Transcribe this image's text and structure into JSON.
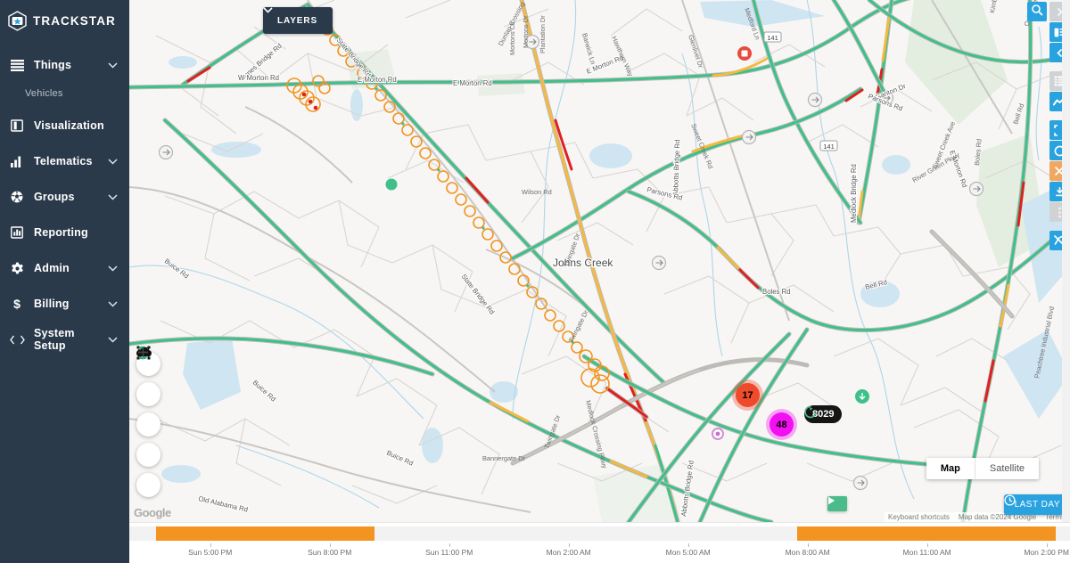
{
  "app": {
    "brand": "TRACKSTAR",
    "brand_icon": "star-hexagon-icon"
  },
  "sidebar": {
    "items": [
      {
        "label": "Things",
        "icon": "list-icon",
        "chevron": true,
        "sub": [
          "Vehicles"
        ]
      },
      {
        "label": "Visualization",
        "icon": "book-icon",
        "chevron": false,
        "sub": []
      },
      {
        "label": "Telematics",
        "icon": "bar-chart-icon",
        "chevron": true,
        "sub": []
      },
      {
        "label": "Groups",
        "icon": "soccer-ball-icon",
        "chevron": true,
        "sub": []
      },
      {
        "label": "Reporting",
        "icon": "report-icon",
        "chevron": false,
        "sub": []
      },
      {
        "label": "Admin",
        "icon": "gear-icon",
        "chevron": true,
        "sub": []
      },
      {
        "label": "Billing",
        "icon": "dollar-icon",
        "chevron": true,
        "sub": []
      },
      {
        "label": "System Setup",
        "icon": "code-icon",
        "chevron": true,
        "sub": []
      }
    ]
  },
  "map": {
    "layers_button": "LAYERS",
    "layers_icon": "chevron-down-icon",
    "search_icon": "search-icon",
    "city_label": "Johns Creek",
    "road_labels": [
      "Jones Bridge Rd",
      "State Bridge Rd",
      "W Morton Rd",
      "E Morton Rd",
      "Mortons Cir",
      "Mortons Dr",
      "Plantation Dr",
      "Dunlap Crossing",
      "Parsons Rd",
      "Medlock Bridge Rd",
      "Abbotts Bridge Rd",
      "Ganton Dr",
      "Bell Rd",
      "Boles Rd",
      "Wilson Rd",
      "Sweet Creek Rd",
      "Sweet Creek Ave",
      "Barwick Ln",
      "Hawthorn Way",
      "Glenlivet Dr",
      "Buice Rd",
      "Twingate Dr",
      "Bannergate Dr",
      "Old Alabama Rd",
      "Medlock Crossing Pkwy",
      "River Green Pkwy",
      "Peachtree Industrial Blvd",
      "Medford Ln"
    ],
    "highway_shields": [
      "141",
      "141"
    ],
    "controls": {
      "select_area": "select-area-icon",
      "traffic": "traffic-light-icon",
      "cluster": "cluster-icon",
      "zoom_in": "plus-icon",
      "zoom_out": "minus-icon"
    },
    "maptype": {
      "map": "Map",
      "satellite": "Satellite",
      "active": "Map"
    },
    "attribution": {
      "keyboard": "Keyboard shortcuts",
      "data": "Map data ©2024 Google",
      "terms": "Terms",
      "logo": "Google"
    },
    "play_icon": "play-icon",
    "markers": [
      {
        "name": "cluster-17",
        "count": "17",
        "color": "#ee4a2b"
      },
      {
        "name": "cluster-48",
        "count": "48",
        "color": "#f20ff2"
      }
    ],
    "vehicle_label": {
      "id": "8029",
      "icon": "arrow-heading-icon"
    }
  },
  "right_rail": {
    "buttons": [
      {
        "name": "expand-panel-button",
        "icon": "chevron-right-icon",
        "state": "disabled"
      },
      {
        "name": "details-panel-button",
        "icon": "list-panel-icon",
        "state": "active"
      },
      {
        "name": "collapse-panel-button",
        "icon": "chevron-left-icon",
        "state": "active"
      },
      {
        "name": "table-view-button",
        "icon": "table-icon",
        "state": "disabled"
      },
      {
        "name": "chart-view-button",
        "icon": "line-chart-icon",
        "state": "active"
      },
      {
        "name": "fullscreen-button",
        "icon": "fullscreen-icon",
        "state": "active"
      },
      {
        "name": "circle-select-button",
        "icon": "circle-icon",
        "state": "active"
      },
      {
        "name": "clear-button",
        "icon": "close-icon",
        "state": "warning"
      },
      {
        "name": "download-button",
        "icon": "download-icon",
        "state": "active"
      },
      {
        "name": "more-options-button",
        "icon": "more-vertical-icon",
        "state": "disabled"
      },
      {
        "name": "hide-routes-button",
        "icon": "route-off-icon",
        "state": "active"
      }
    ]
  },
  "time_range_button": {
    "label": "LAST DAY",
    "icon": "clock-icon"
  },
  "timeline": {
    "ticks": [
      {
        "label": "Sun 5:00 PM",
        "pct": 8.6
      },
      {
        "label": "Sun 8:00 PM",
        "pct": 21.3
      },
      {
        "label": "Sun 11:00 PM",
        "pct": 34.0
      },
      {
        "label": "Mon 2:00 AM",
        "pct": 46.7
      },
      {
        "label": "Mon 5:00 AM",
        "pct": 59.4
      },
      {
        "label": "Mon 8:00 AM",
        "pct": 72.1
      },
      {
        "label": "Mon 11:00 AM",
        "pct": 84.8
      },
      {
        "label": "Mon 2:00 PM",
        "pct": 97.5
      }
    ],
    "segments": [
      {
        "start_pct": 2.8,
        "width_pct": 23.3,
        "color": "#f2941f"
      },
      {
        "start_pct": 71.0,
        "width_pct": 27.5,
        "color": "#f2941f"
      }
    ]
  },
  "colors": {
    "sidebar_bg": "#2b3a4a",
    "accent_blue": "#29a3e0",
    "accent_orange": "#f2941f",
    "traffic_green": "#3ec08a",
    "traffic_yellow": "#f5b942",
    "traffic_red": "#e02020",
    "marker_magenta": "#f20ff2",
    "marker_red": "#ee4a2b"
  }
}
